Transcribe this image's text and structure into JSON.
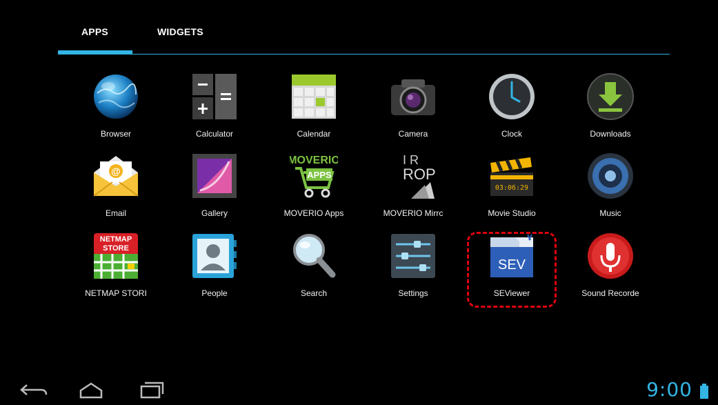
{
  "tabs": {
    "apps": "APPS",
    "widgets": "WIDGETS"
  },
  "apps": [
    {
      "label": "Browser",
      "icon": "browser-globe-icon"
    },
    {
      "label": "Calculator",
      "icon": "calculator-icon"
    },
    {
      "label": "Calendar",
      "icon": "calendar-icon"
    },
    {
      "label": "Camera",
      "icon": "camera-icon"
    },
    {
      "label": "Clock",
      "icon": "clock-icon"
    },
    {
      "label": "Downloads",
      "icon": "download-arrow-icon"
    },
    {
      "label": "Email",
      "icon": "email-envelope-icon"
    },
    {
      "label": "Gallery",
      "icon": "gallery-picture-icon"
    },
    {
      "label": "MOVERIO Apps",
      "icon": "moverio-apps-cart-icon",
      "icon_text_1": "MOVERIO",
      "icon_text_2": "APPS"
    },
    {
      "label": "MOVERIO Mirrc",
      "icon": "moverio-mirror-icon",
      "icon_text_1": "ROP"
    },
    {
      "label": "Movie Studio",
      "icon": "clapperboard-icon",
      "icon_text_1": "03:06:29"
    },
    {
      "label": "Music",
      "icon": "speaker-icon"
    },
    {
      "label": "NETMAP STORI",
      "icon": "netmap-store-icon",
      "icon_text_1": "NETMAP",
      "icon_text_2": "STORE"
    },
    {
      "label": "People",
      "icon": "contacts-person-icon"
    },
    {
      "label": "Search",
      "icon": "magnifier-icon"
    },
    {
      "label": "Settings",
      "icon": "sliders-icon"
    },
    {
      "label": "SEViewer",
      "icon": "seviewer-folder-icon",
      "icon_text_1": "SEV"
    },
    {
      "label": "Sound Recorde",
      "icon": "microphone-icon"
    }
  ],
  "status": {
    "time": "9:00"
  },
  "colors": {
    "accent": "#33b5e5",
    "highlight": "#e0000e",
    "background": "#000000"
  },
  "nav": {
    "back": "back-icon",
    "home": "home-icon",
    "recents": "recents-icon"
  }
}
